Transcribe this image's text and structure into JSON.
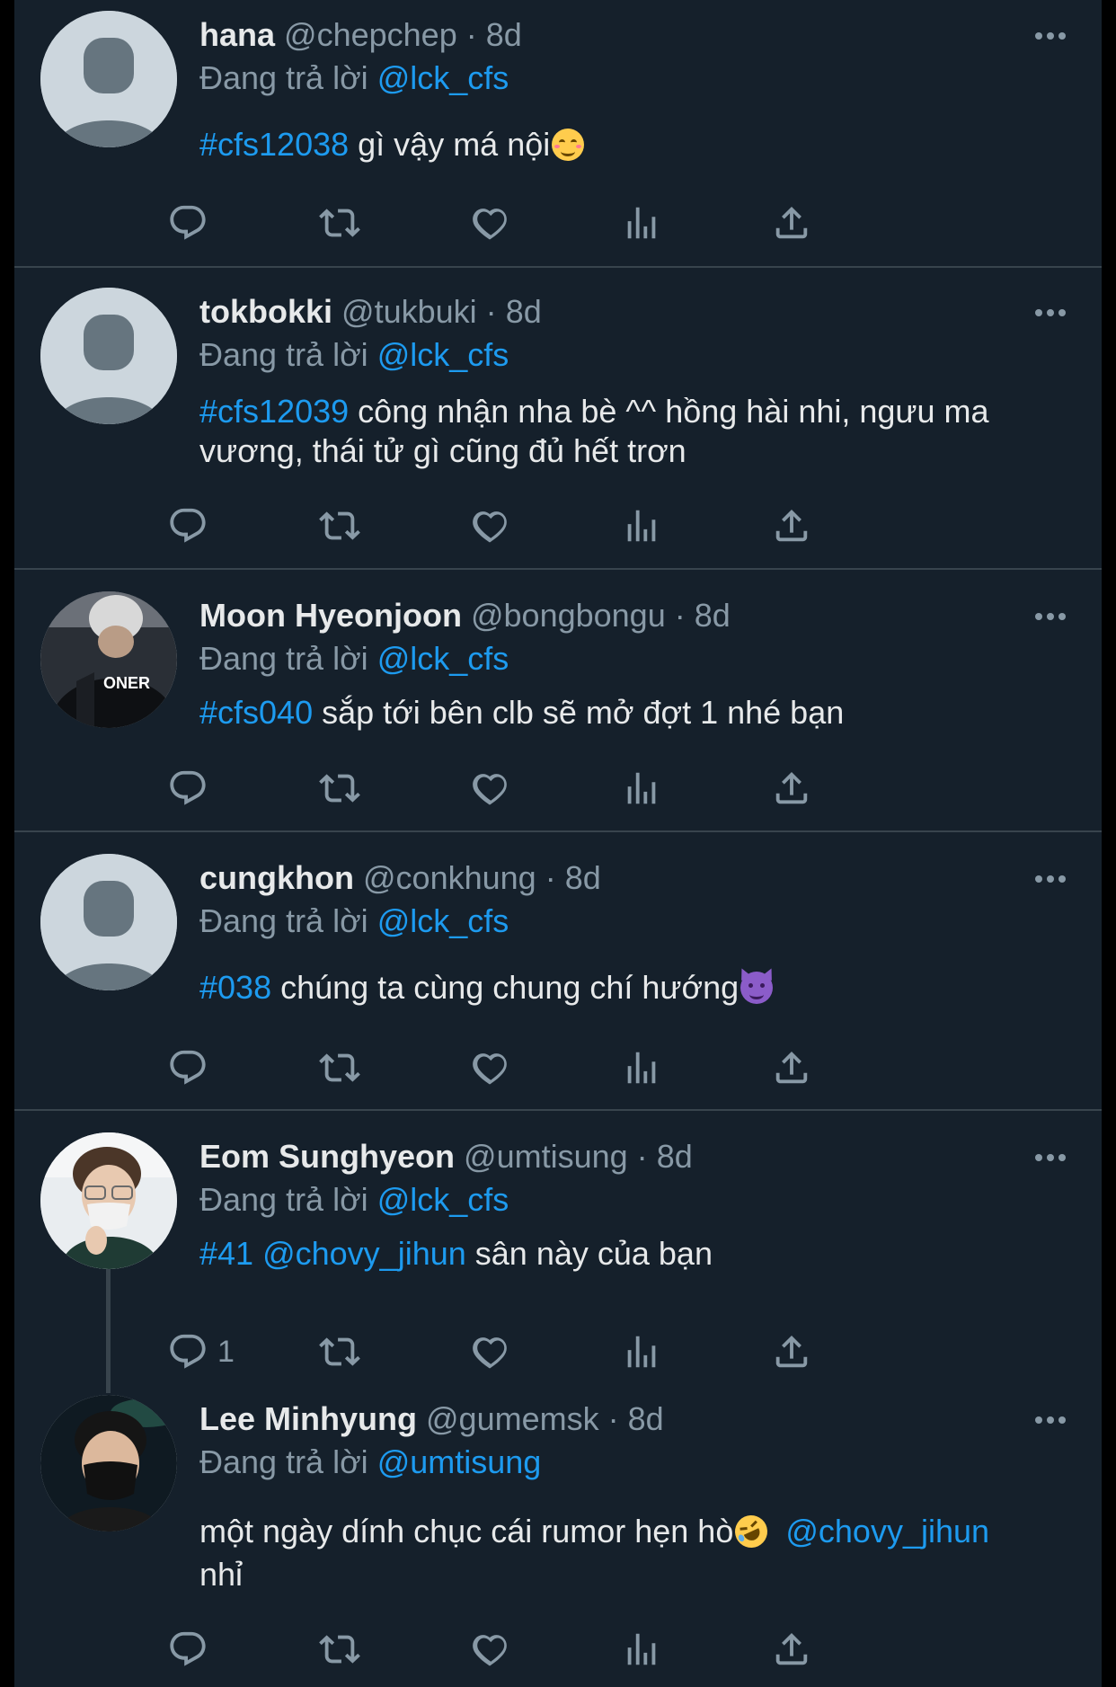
{
  "replying_prefix": "Đang trả lời",
  "tweets": [
    {
      "name": "hana",
      "handle": "@chepchep",
      "sep": "·",
      "time": "8d",
      "reply_to": "@lck_cfs",
      "hashtag": "#cfs12038",
      "text": " gì vậy má nội",
      "emoji": "smiling-face",
      "avatar": "default"
    },
    {
      "name": "tokbokki",
      "handle": "@tukbuki",
      "sep": "·",
      "time": "8d",
      "reply_to": "@lck_cfs",
      "hashtag": "#cfs12039",
      "text": " công nhận nha bè ^^ hồng hài nhi, ngưu ma vương, thái tử gì cũng đủ hết trơn",
      "avatar": "default"
    },
    {
      "name": "Moon Hyeonjoon",
      "handle": "@bongbongu",
      "sep": "·",
      "time": "8d",
      "reply_to": "@lck_cfs",
      "hashtag": "#cfs040",
      "text": " sắp tới bên clb sẽ mở đợt 1 nhé bạn",
      "avatar": "photo",
      "avatar_text": "ONER"
    },
    {
      "name": "cungkhon",
      "handle": "@conkhung",
      "sep": "·",
      "time": "8d",
      "reply_to": "@lck_cfs",
      "hashtag": "#038",
      "text": " chúng ta cùng chung chí hướng",
      "emoji": "smiling-devil",
      "avatar": "default"
    },
    {
      "name": "Eom Sunghyeon",
      "handle": "@umtisung",
      "sep": "·",
      "time": "8d",
      "reply_to": "@lck_cfs",
      "hashtag": "#41",
      "mention": "@chovy_jihun",
      "text": " sân này của bạn",
      "reply_count": "1",
      "avatar": "photo"
    },
    {
      "name": "Lee Minhyung",
      "handle": "@gumemsk",
      "sep": "·",
      "time": "8d",
      "reply_to": "@umtisung",
      "text": "một ngày dính chục cái rumor hẹn hò",
      "emoji": "rolling-laughing",
      "mention": "@chovy_jihun",
      "text_end": "nhỉ",
      "avatar": "photo"
    }
  ],
  "action_icons": [
    "reply-icon",
    "retweet-icon",
    "like-icon",
    "views-icon",
    "share-icon"
  ],
  "colors": {
    "background": "#15202b",
    "text": "#e7e9ea",
    "muted": "#8899a6",
    "link": "#1d9bf0",
    "divider": "#38444d"
  }
}
